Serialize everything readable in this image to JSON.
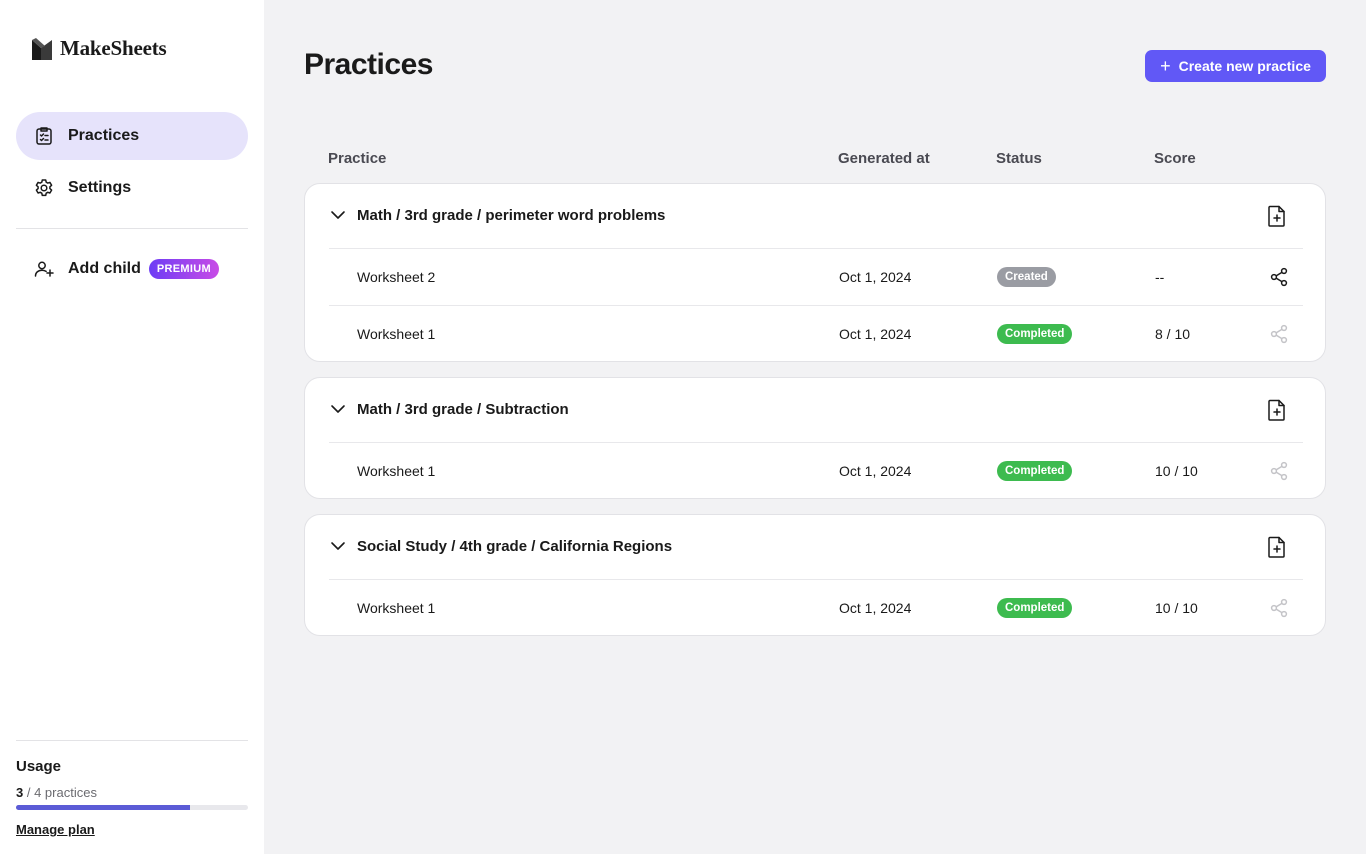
{
  "app": {
    "name": "MakeSheets"
  },
  "sidebar": {
    "items": [
      {
        "label": "Practices",
        "icon": "clipboard-list-icon",
        "active": true
      },
      {
        "label": "Settings",
        "icon": "gear-icon",
        "active": false
      }
    ],
    "add_child": {
      "label": "Add child",
      "icon": "user-plus-icon",
      "badge": "PREMIUM"
    },
    "usage": {
      "title": "Usage",
      "used": "3",
      "total_text": "/ 4 practices",
      "progress": 0.75,
      "manage_label": "Manage plan"
    }
  },
  "main": {
    "title": "Practices",
    "create_button": {
      "label": "Create new practice",
      "icon": "plus-icon"
    },
    "columns": {
      "practice": "Practice",
      "generated_at": "Generated at",
      "status": "Status",
      "score": "Score"
    },
    "groups": [
      {
        "title": "Math / 3rd grade / perimeter word problems",
        "rows": [
          {
            "name": "Worksheet 2",
            "date": "Oct 1, 2024",
            "status": "Created",
            "score": "--",
            "share_enabled": true
          },
          {
            "name": "Worksheet 1",
            "date": "Oct 1, 2024",
            "status": "Completed",
            "score": "8 / 10",
            "share_enabled": false
          }
        ]
      },
      {
        "title": "Math / 3rd grade / Subtraction",
        "rows": [
          {
            "name": "Worksheet 1",
            "date": "Oct 1, 2024",
            "status": "Completed",
            "score": "10 / 10",
            "share_enabled": false
          }
        ]
      },
      {
        "title": "Social Study / 4th grade / California Regions",
        "rows": [
          {
            "name": "Worksheet 1",
            "date": "Oct 1, 2024",
            "status": "Completed",
            "score": "10 / 10",
            "share_enabled": false
          }
        ]
      }
    ]
  },
  "colors": {
    "accent": "#6158f6",
    "active_nav_bg": "#e6e3fb",
    "status_created": "#9a9ca3",
    "status_completed": "#3dbb4f",
    "premium_gradient_start": "#6d3df5",
    "premium_gradient_end": "#c84be6"
  }
}
